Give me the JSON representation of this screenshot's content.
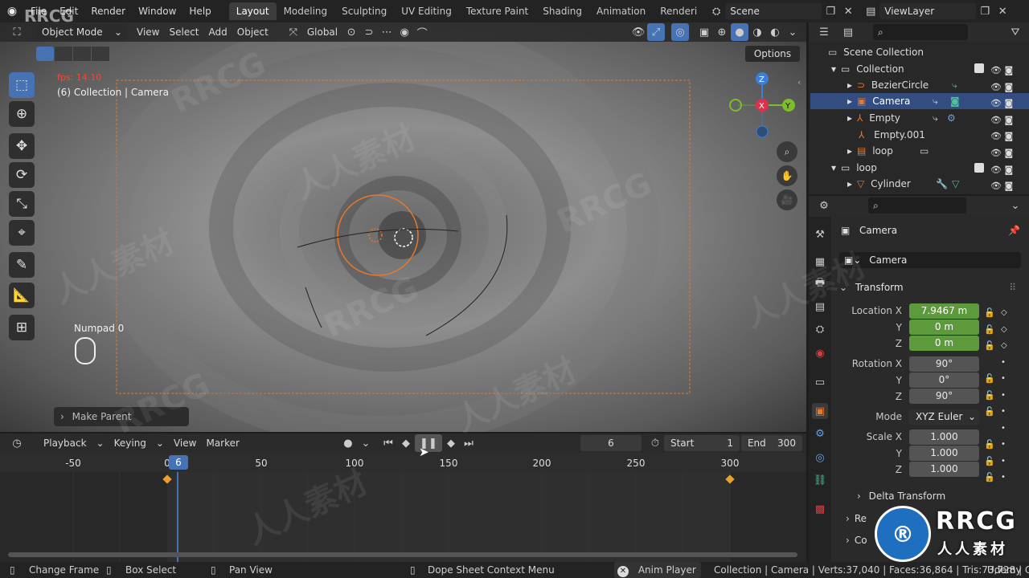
{
  "app": {
    "logo": "blender-logo-icon"
  },
  "menu": [
    "File",
    "Edit",
    "Render",
    "Window",
    "Help"
  ],
  "workspaces": [
    "Layout",
    "Modeling",
    "Sculpting",
    "UV Editing",
    "Texture Paint",
    "Shading",
    "Animation",
    "Renderi"
  ],
  "scene": {
    "name": "Scene",
    "view_layer": "ViewLayer"
  },
  "viewport_header": {
    "mode": "Object Mode",
    "view": "View",
    "select": "Select",
    "add": "Add",
    "object": "Object",
    "orientation": "Global",
    "options": "Options"
  },
  "viewport": {
    "fps": "fps: 14.10",
    "info": "(6) Collection | Camera",
    "numpad": "Numpad 0",
    "last_op": "Make Parent"
  },
  "outliner": {
    "root": "Scene Collection",
    "rows": [
      {
        "label": "Collection",
        "indent": 0
      },
      {
        "label": "BezierCircle",
        "indent": 1
      },
      {
        "label": "Camera",
        "indent": 1
      },
      {
        "label": "Empty",
        "indent": 1
      },
      {
        "label": "Empty.001",
        "indent": 1
      },
      {
        "label": "loop",
        "indent": 1
      },
      {
        "label": "loop",
        "indent": 0
      },
      {
        "label": "Cylinder",
        "indent": 1
      }
    ]
  },
  "properties": {
    "object_name": "Camera",
    "data_name": "Camera",
    "panel": "Transform",
    "location_label": "Location X",
    "location": [
      "7.9467 m",
      "0 m",
      "0 m"
    ],
    "rotation_label": "Rotation X",
    "rotation": [
      "90°",
      "0°",
      "90°"
    ],
    "mode_label": "Mode",
    "mode": "XYZ Euler",
    "scale_label": "Scale X",
    "scale": [
      "1.000",
      "1.000",
      "1.000"
    ],
    "axis_y": "Y",
    "axis_z": "Z",
    "delta": "Delta Transform",
    "re": "Re",
    "co": "Co"
  },
  "timeline": {
    "playback": "Playback",
    "keying": "Keying",
    "view": "View",
    "marker": "Marker",
    "current_frame": "6",
    "start_label": "Start",
    "start": "1",
    "end_label": "End",
    "end": "300",
    "ticks": [
      "-50",
      "0",
      "50",
      "100",
      "150",
      "200",
      "250",
      "300"
    ],
    "playhead": "6"
  },
  "statusbar": {
    "change_frame": "Change Frame",
    "box_select": "Box Select",
    "pan_view": "Pan View",
    "context_menu": "Dope Sheet Context Menu",
    "anim_player": "Anim Player",
    "stats": "Collection | Camera | Verts:37,040 | Faces:36,864 | Tris:73,728 | Ob"
  },
  "watermark": {
    "brand": "RRCG",
    "sub": "人人素材",
    "corner": "Udemy"
  },
  "colors": {
    "accent": "#4772b3",
    "green": "#5c9a3c",
    "orange": "#e8782c",
    "axis_x": "#e0304a",
    "axis_y": "#7bbd2a",
    "axis_z": "#3b7fd9"
  }
}
